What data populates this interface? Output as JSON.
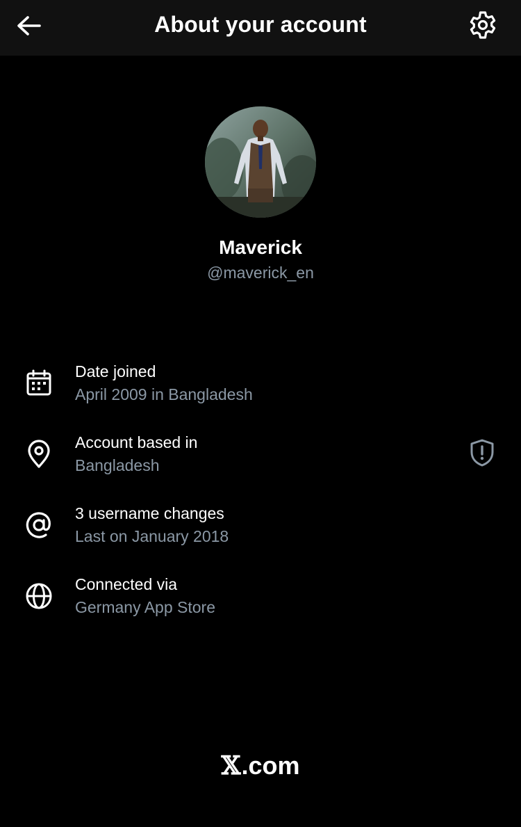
{
  "header": {
    "title": "About your account",
    "back_icon": "arrow-left-icon",
    "settings_icon": "gear-icon"
  },
  "profile": {
    "display_name": "Maverick",
    "handle": "@maverick_en"
  },
  "info_rows": [
    {
      "icon": "calendar-icon",
      "label": "Date joined",
      "value": "April 2009 in Bangladesh"
    },
    {
      "icon": "location-pin-icon",
      "label": "Account based in",
      "value": "Bangladesh",
      "trailing_icon": "shield-alert-icon"
    },
    {
      "icon": "at-sign-icon",
      "label": "3 username changes",
      "value": "Last on January 2018"
    },
    {
      "icon": "globe-icon",
      "label": "Connected via",
      "value": "Germany App Store"
    }
  ],
  "footer": {
    "logo_mark": "𝕏",
    "logo_text": ".com"
  },
  "colors": {
    "background": "#000000",
    "header_background": "#111111",
    "primary_text": "#ffffff",
    "secondary_text": "#8b98a5"
  }
}
